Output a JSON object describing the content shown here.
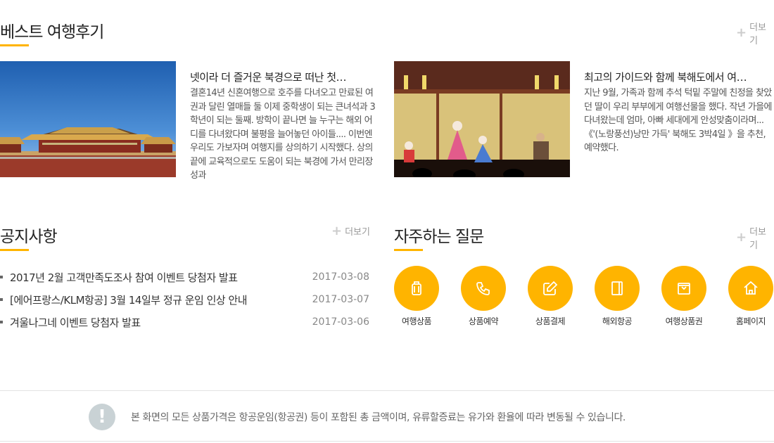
{
  "reviews_section": {
    "title": "베스트 여행후기",
    "more_label": "더보기",
    "items": [
      {
        "title": "넷이라 더 즐거운 북경으로 떠난 첫…",
        "text": "결혼14년 신혼여행으로 호주를 다녀오고 만료된 여권과 달린 열매들 둘 이제 중학생이 되는 큰녀석과 3학년이 되는 둘째. 방학이 끝나면 늘 누구는 해외 어디를 다녀왔다며 불평을 늘어놓던 아이들.... 이번엔 우리도 가보자며 여행지를 상의하기 시작했다. 상의 끝에 교육적으로도 도움이 되는 북경에 가서 만리장성과",
        "image": "forbidden-city-photo"
      },
      {
        "title": "최고의 가이드와 함께 북해도에서 여…",
        "text": "지난 9월, 가족과 함께 추석 턱밑 주말에 친정을 찾았던 딸이 우리 부부에게 여행선물을 했다. 작년 가을에 다녀왔는데 엄마, 아빠 세대에게 안성맞춤이라며... 《'(노랑풍선)낭만 가득' 북해도 3박4일 》을 추천, 예약했다.",
        "image": "kabuki-stage-photo"
      }
    ]
  },
  "notice_section": {
    "title": "공지사항",
    "more_label": "더보기",
    "items": [
      {
        "text": "2017년 2월 고객만족도조사 참여 이벤트 당첨자 발표",
        "date": "2017-03-08"
      },
      {
        "text": "[에어프랑스/KLM항공] 3월 14일부 정규 운임 인상 안내",
        "date": "2017-03-07"
      },
      {
        "text": "겨울나그네 이벤트 당첨자 발표",
        "date": "2017-03-06"
      }
    ]
  },
  "faq_section": {
    "title": "자주하는 질문",
    "more_label": "더보기",
    "items": [
      {
        "label": "여행상품",
        "icon": "suitcase-icon"
      },
      {
        "label": "상품예약",
        "icon": "phone-icon"
      },
      {
        "label": "상품결제",
        "icon": "edit-icon"
      },
      {
        "label": "해외항공",
        "icon": "passport-icon"
      },
      {
        "label": "여행상품권",
        "icon": "voucher-icon"
      },
      {
        "label": "홈페이지",
        "icon": "home-icon"
      }
    ]
  },
  "footer_notice": {
    "icon": "exclamation-icon",
    "text": "본 화면의 모든 상품가격은 항공운임(항공권) 등이 포함된 총 금액이며, 유류할증료는 유가와 환율에 따라 변동될 수 있습니다."
  },
  "colors": {
    "accent": "#ffb400",
    "info_icon": "#c9d2d5"
  }
}
